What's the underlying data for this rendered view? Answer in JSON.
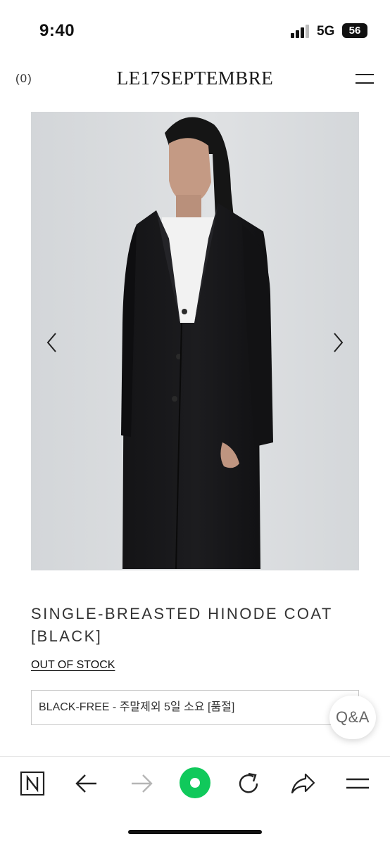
{
  "status_bar": {
    "time": "9:40",
    "network": "5G",
    "battery": "56"
  },
  "header": {
    "cart_count": "(0)",
    "brand": "LE17SEPTEMBRE",
    "menu_icon": "hamburger-menu-icon"
  },
  "product": {
    "image_description_icon": "product-photo",
    "title_line1": "SINGLE-BREASTED HINODE COAT",
    "title_line2": "[BLACK]",
    "stock_status": "OUT OF STOCK",
    "option_selected": "BLACK-FREE - 주말제외 5일 소요 [품절]"
  },
  "floating": {
    "qa_label": "Q&A"
  },
  "toolbar": {
    "items": [
      {
        "icon": "naver-n-icon"
      },
      {
        "icon": "back-arrow-icon"
      },
      {
        "icon": "forward-arrow-icon"
      },
      {
        "icon": "green-dot-icon"
      },
      {
        "icon": "reload-icon"
      },
      {
        "icon": "share-icon"
      },
      {
        "icon": "menu-icon"
      }
    ]
  },
  "colors": {
    "accent_green": "#10c95b",
    "text_dark": "#1a1a1a",
    "border": "#c9c9c9",
    "disabled_arrow": "#b5b5b5"
  }
}
